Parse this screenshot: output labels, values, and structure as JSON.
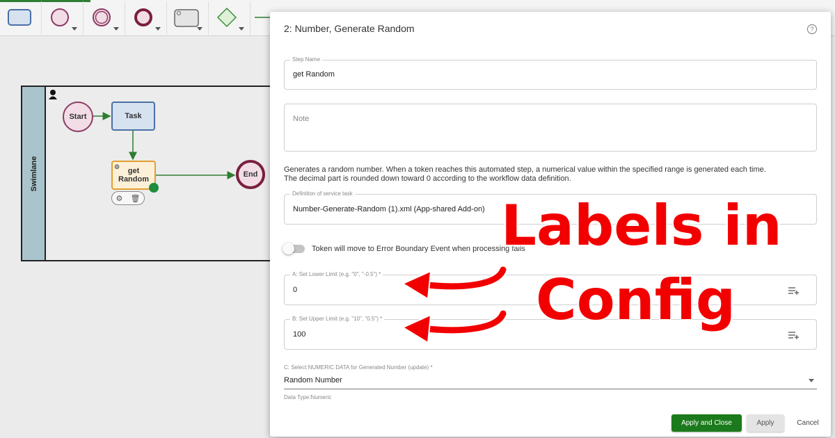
{
  "toolbar": {
    "tools": [
      {
        "icon": "task-shape-icon"
      },
      {
        "icon": "start-event-icon"
      },
      {
        "icon": "intermediate-event-icon"
      },
      {
        "icon": "end-event-icon"
      },
      {
        "icon": "service-task-icon"
      },
      {
        "icon": "gateway-icon"
      }
    ]
  },
  "diagram": {
    "lane_label": "Swimlane",
    "start_label": "Start",
    "task_label": "Task",
    "service_task_label_line1": "get",
    "service_task_label_line2": "Random",
    "end_label": "End"
  },
  "dialog": {
    "title": "2: Number, Generate Random",
    "step_name": {
      "label": "Step Name",
      "value": "get Random"
    },
    "note": {
      "placeholder": "Note"
    },
    "description_line1": "Generates a random number. When a token reaches this automated step, a numerical value within the specified range is generated each time.",
    "description_line2": "The decimal part is rounded down toward 0 according to the workflow data definition.",
    "definition": {
      "label": "Definition of service task",
      "value": "Number-Generate-Random (1).xml (App-shared Add-on)"
    },
    "toggle_label": "Token will move to Error Boundary Event when processing fails",
    "lower_limit": {
      "label": "A: Set Lower Limit (e.g. \"0\", \"-0.5\") *",
      "value": "0"
    },
    "upper_limit": {
      "label": "B: Set Upper Limit (e.g. \"10\", \"0.5\") *",
      "value": "100"
    },
    "numeric_select": {
      "label": "C: Select NUMERIC DATA for Generated Number (update) *",
      "value": "Random Number",
      "helper": "Data Type:Numeric"
    },
    "buttons": {
      "apply_close": "Apply and Close",
      "apply": "Apply",
      "cancel": "Cancel"
    }
  },
  "overlay": {
    "line1": "Labels in",
    "line2": "Config",
    "color": "#f20000"
  },
  "colors": {
    "primary_button": "#1b7a1b",
    "lane_header": "#a9c4cc",
    "flow": "#2e7d32"
  }
}
